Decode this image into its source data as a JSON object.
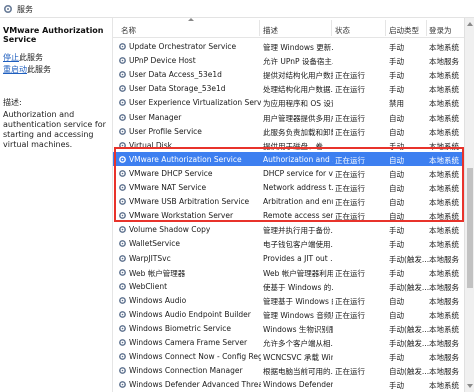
{
  "window": {
    "title": "服务"
  },
  "left_pane": {
    "service_title": "VMware Authorization Service",
    "actions": [
      {
        "link": "停止",
        "rest": "此服务"
      },
      {
        "link": "重启动",
        "rest": "此服务"
      }
    ],
    "description_label": "描述:",
    "description": "Authorization and authentication service for starting and accessing virtual machines."
  },
  "columns": {
    "name": "名称",
    "description": "描述",
    "status": "状态",
    "startup": "启动类型",
    "logon": "登录为"
  },
  "rows": [
    {
      "name": "Update Orchestrator Service",
      "desc": "管理 Windows 更新...",
      "status": "",
      "startup": "手动",
      "logon": "本地系统"
    },
    {
      "name": "UPnP Device Host",
      "desc": "允许 UPnP 设备宿主...",
      "status": "",
      "startup": "手动",
      "logon": "本地服务"
    },
    {
      "name": "User Data Access_53e1d",
      "desc": "提供对结构化用户数据...",
      "status": "正在运行",
      "startup": "手动",
      "logon": "本地系统"
    },
    {
      "name": "User Data Storage_53e1d",
      "desc": "处理结构化用户数据...",
      "status": "正在运行",
      "startup": "手动",
      "logon": "本地系统"
    },
    {
      "name": "User Experience Virtualization Service",
      "desc": "为应用程序和 OS 设置...",
      "status": "",
      "startup": "禁用",
      "logon": "本地系统"
    },
    {
      "name": "User Manager",
      "desc": "用户管理器提供多用户...",
      "status": "正在运行",
      "startup": "自动",
      "logon": "本地系统"
    },
    {
      "name": "User Profile Service",
      "desc": "此服务负责加载和卸载...",
      "status": "正在运行",
      "startup": "自动",
      "logon": "本地系统"
    },
    {
      "name": "Virtual Disk",
      "desc": "提供用于磁盘、卷...",
      "status": "",
      "startup": "手动",
      "logon": "本地系统"
    },
    {
      "name": "VMware Authorization Service",
      "desc": "Authorization and ...",
      "status": "正在运行",
      "startup": "自动",
      "logon": "本地系统",
      "selected": true
    },
    {
      "name": "VMware DHCP Service",
      "desc": "DHCP service for vi...",
      "status": "正在运行",
      "startup": "自动",
      "logon": "本地系统"
    },
    {
      "name": "VMware NAT Service",
      "desc": "Network address t...",
      "status": "正在运行",
      "startup": "自动",
      "logon": "本地系统"
    },
    {
      "name": "VMware USB Arbitration Service",
      "desc": "Arbitration and enu...",
      "status": "正在运行",
      "startup": "自动",
      "logon": "本地系统"
    },
    {
      "name": "VMware Workstation Server",
      "desc": "Remote access ser...",
      "status": "正在运行",
      "startup": "自动",
      "logon": "本地系统"
    },
    {
      "name": "Volume Shadow Copy",
      "desc": "管理并执行用于备份...",
      "status": "",
      "startup": "手动",
      "logon": "本地系统"
    },
    {
      "name": "WalletService",
      "desc": "电子钱包客户端使用...",
      "status": "",
      "startup": "手动",
      "logon": "本地系统"
    },
    {
      "name": "WarpJITSvc",
      "desc": "Provides a JIT out ...",
      "status": "",
      "startup": "手动(触发...",
      "logon": "本地服务"
    },
    {
      "name": "Web 帐户管理器",
      "desc": "Web 帐户管理器利用...",
      "status": "正在运行",
      "startup": "手动",
      "logon": "本地系统"
    },
    {
      "name": "WebClient",
      "desc": "使基于 Windows 的...",
      "status": "",
      "startup": "手动(触发...",
      "logon": "本地服务"
    },
    {
      "name": "Windows Audio",
      "desc": "管理基于 Windows 的...",
      "status": "正在运行",
      "startup": "自动",
      "logon": "本地服务"
    },
    {
      "name": "Windows Audio Endpoint Builder",
      "desc": "管理 Windows 音频服...",
      "status": "正在运行",
      "startup": "自动",
      "logon": "本地系统"
    },
    {
      "name": "Windows Biometric Service",
      "desc": "Windows 生物识别服...",
      "status": "",
      "startup": "手动(触发...",
      "logon": "本地系统"
    },
    {
      "name": "Windows Camera Frame Server",
      "desc": "允许多个客户端从相...",
      "status": "",
      "startup": "手动(触发...",
      "logon": "本地服务"
    },
    {
      "name": "Windows Connect Now - Config Registrar",
      "desc": "WCNCSVC 承载 Wind...",
      "status": "",
      "startup": "手动",
      "logon": "本地服务"
    },
    {
      "name": "Windows Connection Manager",
      "desc": "根据电脑当前可用的...",
      "status": "正在运行",
      "startup": "自动(触发...",
      "logon": "本地服务"
    },
    {
      "name": "Windows Defender Advanced Threat P...",
      "desc": "Windows Defender ...",
      "status": "",
      "startup": "手动",
      "logon": "本地系统"
    }
  ],
  "colors": {
    "selection": "#3d7ff0",
    "highlight_box": "#e8332b",
    "link": "#1f5fbf"
  }
}
